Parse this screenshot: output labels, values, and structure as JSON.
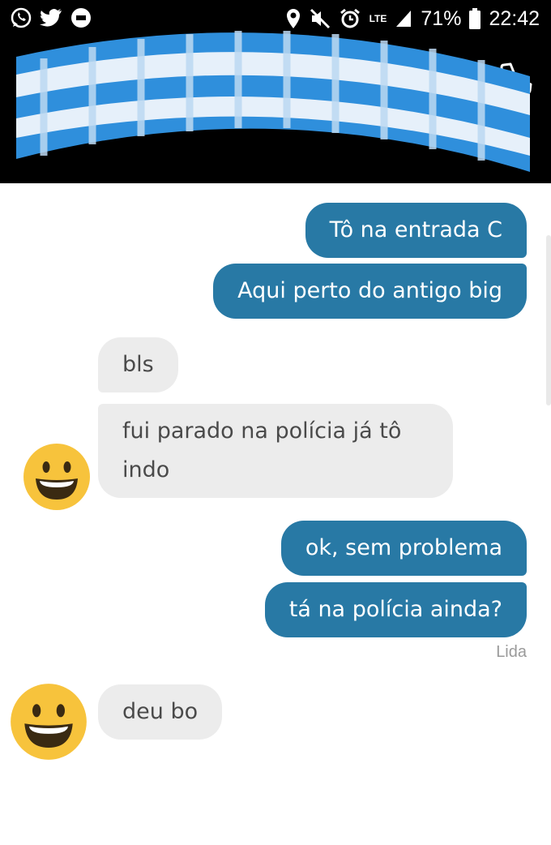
{
  "status_bar": {
    "left_icons": [
      "whatsapp-icon",
      "twitter-icon",
      "uber-icon"
    ],
    "right_icons": [
      "location-icon",
      "muted-icon",
      "alarm-icon",
      "signal-icon",
      "battery-icon"
    ],
    "network": "LTE",
    "battery": "71%",
    "time": "22:42"
  },
  "header": {
    "back_icon": "arrow-left-icon",
    "call_icon": "phone-icon",
    "banner_colors": [
      "#2f8fdc",
      "#e6f0fa"
    ]
  },
  "messages": [
    {
      "from": "me",
      "text": "Tô na entrada C"
    },
    {
      "from": "me",
      "text": "Aqui perto do antigo big"
    },
    {
      "from": "them",
      "text": "bls"
    },
    {
      "from": "them",
      "text": "fui parado na polícia já tô indo"
    },
    {
      "from": "me",
      "text": "ok, sem problema"
    },
    {
      "from": "me",
      "text": "tá na polícia ainda?"
    },
    {
      "from": "them",
      "text": "deu bo"
    }
  ],
  "read_receipt": "Lida",
  "colors": {
    "outgoing": "#2879a5",
    "incoming": "#ececec",
    "avatar": "#f7c33c"
  }
}
